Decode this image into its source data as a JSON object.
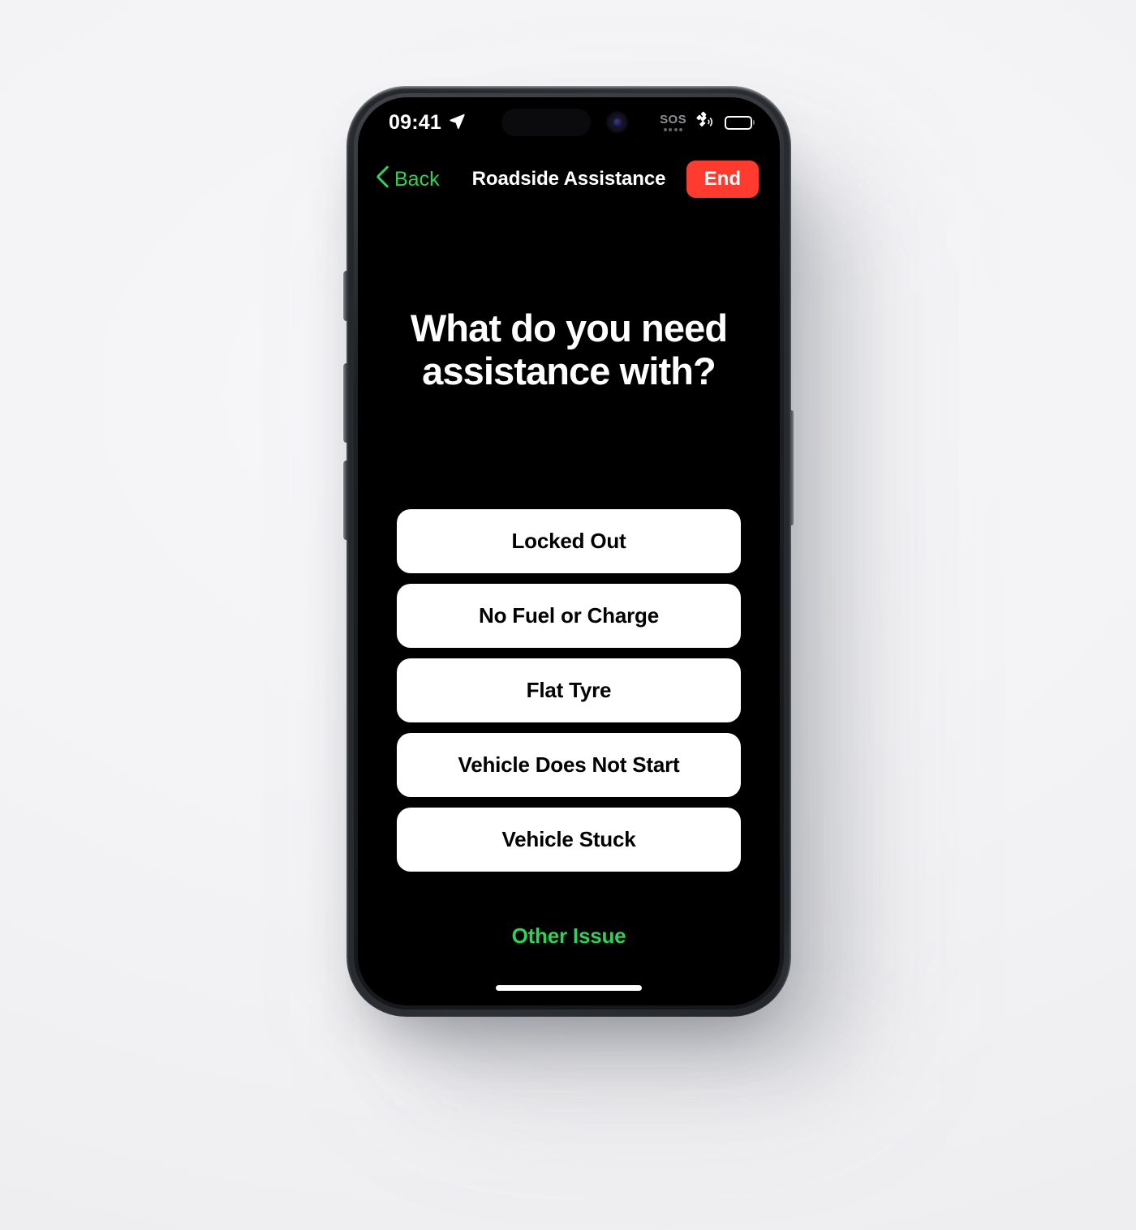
{
  "background": {
    "color": "#f4f4f6"
  },
  "device": {
    "frame_color": "#2d3035",
    "screen_background": "#000000",
    "hardware_buttons": [
      {
        "name": "action-button"
      },
      {
        "name": "volume-up-button"
      },
      {
        "name": "volume-down-button"
      },
      {
        "name": "power-button"
      }
    ]
  },
  "status_bar": {
    "time": "09:41",
    "location_icon": "location-arrow-icon",
    "dynamic_island": "dynamic-island",
    "camera_icon": "front-camera-icon",
    "sos_label": "SOS",
    "sos_dots": 4,
    "satellite_icon": "satellite-icon",
    "battery_icon": "battery-icon",
    "battery_level": 100
  },
  "nav_bar": {
    "back_label": "Back",
    "back_icon": "chevron-left-icon",
    "title": "Roadside Assistance",
    "end_label": "End",
    "end_color": "#ff3b30",
    "accent_color": "#30d158"
  },
  "main": {
    "headline": "What do you need assistance with?",
    "options": [
      {
        "label": "Locked Out"
      },
      {
        "label": "No Fuel or Charge"
      },
      {
        "label": "Flat Tyre"
      },
      {
        "label": "Vehicle Does Not Start"
      },
      {
        "label": "Vehicle Stuck"
      }
    ],
    "other_issue_label": "Other Issue"
  },
  "home_indicator": "home-indicator"
}
